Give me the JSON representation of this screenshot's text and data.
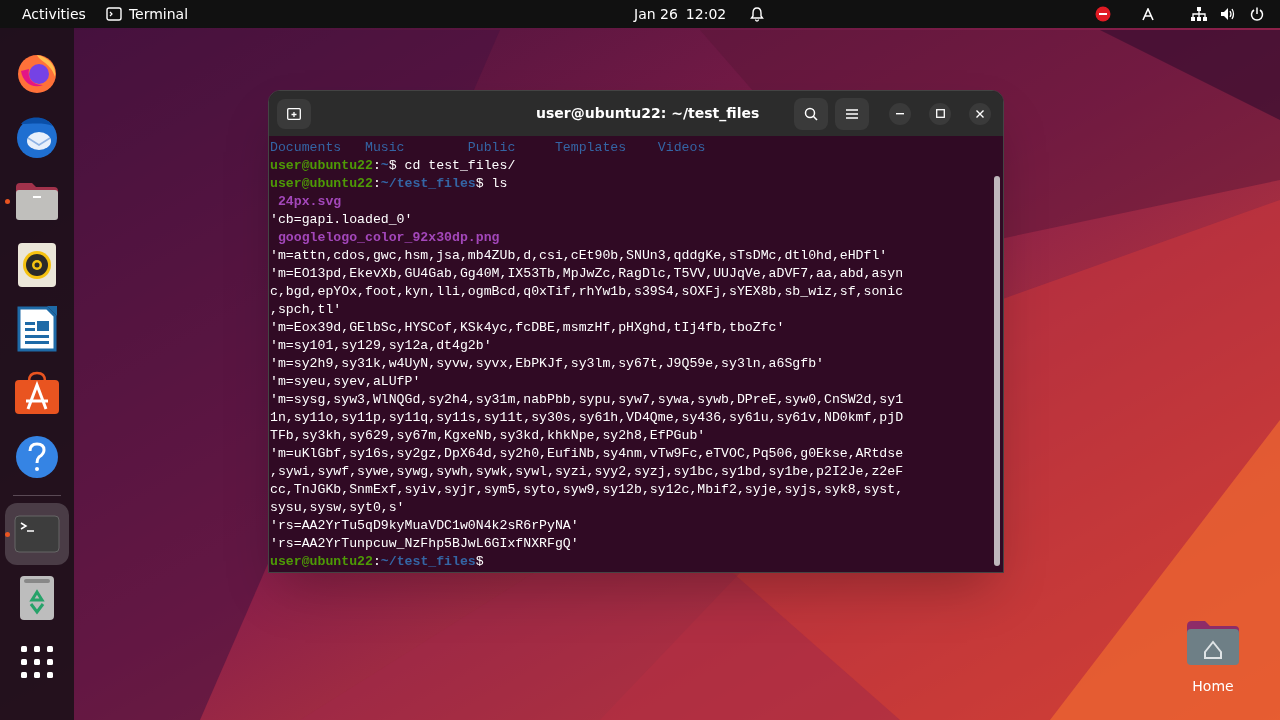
{
  "top_bar": {
    "activities": "Activities",
    "app": "Terminal",
    "date": "Jan 26",
    "time": "12:02"
  },
  "dock": [
    {
      "kind": "firefox",
      "running": false,
      "selected": false
    },
    {
      "kind": "mail",
      "running": false,
      "selected": false
    },
    {
      "kind": "files",
      "running": true,
      "selected": false
    },
    {
      "kind": "speaker",
      "running": false,
      "selected": false
    },
    {
      "kind": "writer",
      "running": false,
      "selected": false
    },
    {
      "kind": "store",
      "running": false,
      "selected": false
    },
    {
      "kind": "help",
      "running": false,
      "selected": false
    },
    {
      "kind": "terminal",
      "running": true,
      "selected": true
    },
    {
      "kind": "trash",
      "running": false,
      "selected": false
    },
    {
      "kind": "apps",
      "running": false,
      "selected": false
    }
  ],
  "desktop_icons": [
    {
      "label": "Home"
    }
  ],
  "window": {
    "title": "user@ubuntu22: ~/test_files",
    "lines": [
      [
        {
          "kind": "dir",
          "text": "Documents   "
        },
        {
          "kind": "dir",
          "text": "Music        "
        },
        {
          "kind": "dir",
          "text": "Public     "
        },
        {
          "kind": "dir",
          "text": "Templates    "
        },
        {
          "kind": "dir",
          "text": "Videos"
        }
      ],
      [
        {
          "kind": "user",
          "text": "user@ubuntu22"
        },
        {
          "kind": "plain",
          "text": ":"
        },
        {
          "kind": "path",
          "text": "~"
        },
        {
          "kind": "plain",
          "text": "$ cd test_files/"
        }
      ],
      [
        {
          "kind": "user",
          "text": "user@ubuntu22"
        },
        {
          "kind": "plain",
          "text": ":"
        },
        {
          "kind": "path",
          "text": "~/test_files"
        },
        {
          "kind": "plain",
          "text": "$ ls"
        }
      ],
      [
        {
          "text": " 24px.svg"
        }
      ],
      [
        {
          "kind": "plain",
          "text": "'cb=gapi.loaded_0'"
        }
      ],
      [
        {
          "text": " googlelogo_color_92x30dp.png"
        }
      ],
      [
        {
          "kind": "plain",
          "text": "'m=attn,cdos,gwc,hsm,jsa,mb4ZUb,d,csi,cEt90b,SNUn3,qddgKe,sTsDMc,dtl0hd,eHDfl'"
        }
      ],
      [
        {
          "kind": "plain",
          "text": "'m=EO13pd,EkevXb,GU4Gab,Gg40M,IX53Tb,MpJwZc,RagDlc,T5VV,UUJqVe,aDVF7,aa,abd,asyn"
        }
      ],
      [
        {
          "kind": "plain",
          "text": "c,bgd,epYOx,foot,kyn,lli,ogmBcd,q0xTif,rhYw1b,s39S4,sOXFj,sYEX8b,sb_wiz,sf,sonic"
        }
      ],
      [
        {
          "kind": "plain",
          "text": ",spch,tl'"
        }
      ],
      [
        {
          "kind": "plain",
          "text": "'m=Eox39d,GElbSc,HYSCof,KSk4yc,fcDBE,msmzHf,pHXghd,tIj4fb,tboZfc'"
        }
      ],
      [
        {
          "kind": "plain",
          "text": "'m=sy101,sy129,sy12a,dt4g2b'"
        }
      ],
      [
        {
          "kind": "plain",
          "text": "'m=sy2h9,sy31k,w4UyN,syvw,syvx,EbPKJf,sy3lm,sy67t,J9Q59e,sy3ln,a6Sgfb'"
        }
      ],
      [
        {
          "kind": "plain",
          "text": "'m=syeu,syev,aLUfP'"
        }
      ],
      [
        {
          "kind": "plain",
          "text": "'m=sysg,syw3,WlNQGd,sy2h4,sy31m,nabPbb,sypu,syw7,sywa,sywb,DPreE,syw0,CnSW2d,sy1"
        }
      ],
      [
        {
          "kind": "plain",
          "text": "1n,sy11o,sy11p,sy11q,sy11s,sy11t,sy30s,sy61h,VD4Qme,sy436,sy61u,sy61v,ND0kmf,pjD"
        }
      ],
      [
        {
          "kind": "plain",
          "text": "TFb,sy3kh,sy629,sy67m,KgxeNb,sy3kd,khkNpe,sy2h8,EfPGub'"
        }
      ],
      [
        {
          "kind": "plain",
          "text": "'m=uKlGbf,sy16s,sy2gz,DpX64d,sy2h0,EufiNb,sy4nm,vTw9Fc,eTVOC,Pq506,g0Ekse,ARtdse"
        }
      ],
      [
        {
          "kind": "plain",
          "text": ",sywi,sywf,sywe,sywg,sywh,sywk,sywl,syzi,syy2,syzj,sy1bc,sy1bd,sy1be,p2I2Je,z2eF"
        }
      ],
      [
        {
          "kind": "plain",
          "text": "cc,TnJGKb,SnmExf,syiv,syjr,sym5,syto,syw9,sy12b,sy12c,Mbif2,syje,syjs,syk8,syst,"
        }
      ],
      [
        {
          "kind": "plain",
          "text": "sysu,sysw,syt0,s'"
        }
      ],
      [
        {
          "kind": "plain",
          "text": "'rs=AA2YrTu5qD9kyMuaVDC1w0N4k2sR6rPyNA'"
        }
      ],
      [
        {
          "kind": "plain",
          "text": "'rs=AA2YrTunpcuw_NzFhp5BJwL6GIxfNXRFgQ'"
        }
      ],
      [
        {
          "kind": "user",
          "text": "user@ubuntu22"
        },
        {
          "kind": "plain",
          "text": ":"
        },
        {
          "kind": "path",
          "text": "~/test_files"
        },
        {
          "kind": "plain",
          "text": "$"
        }
      ]
    ]
  }
}
